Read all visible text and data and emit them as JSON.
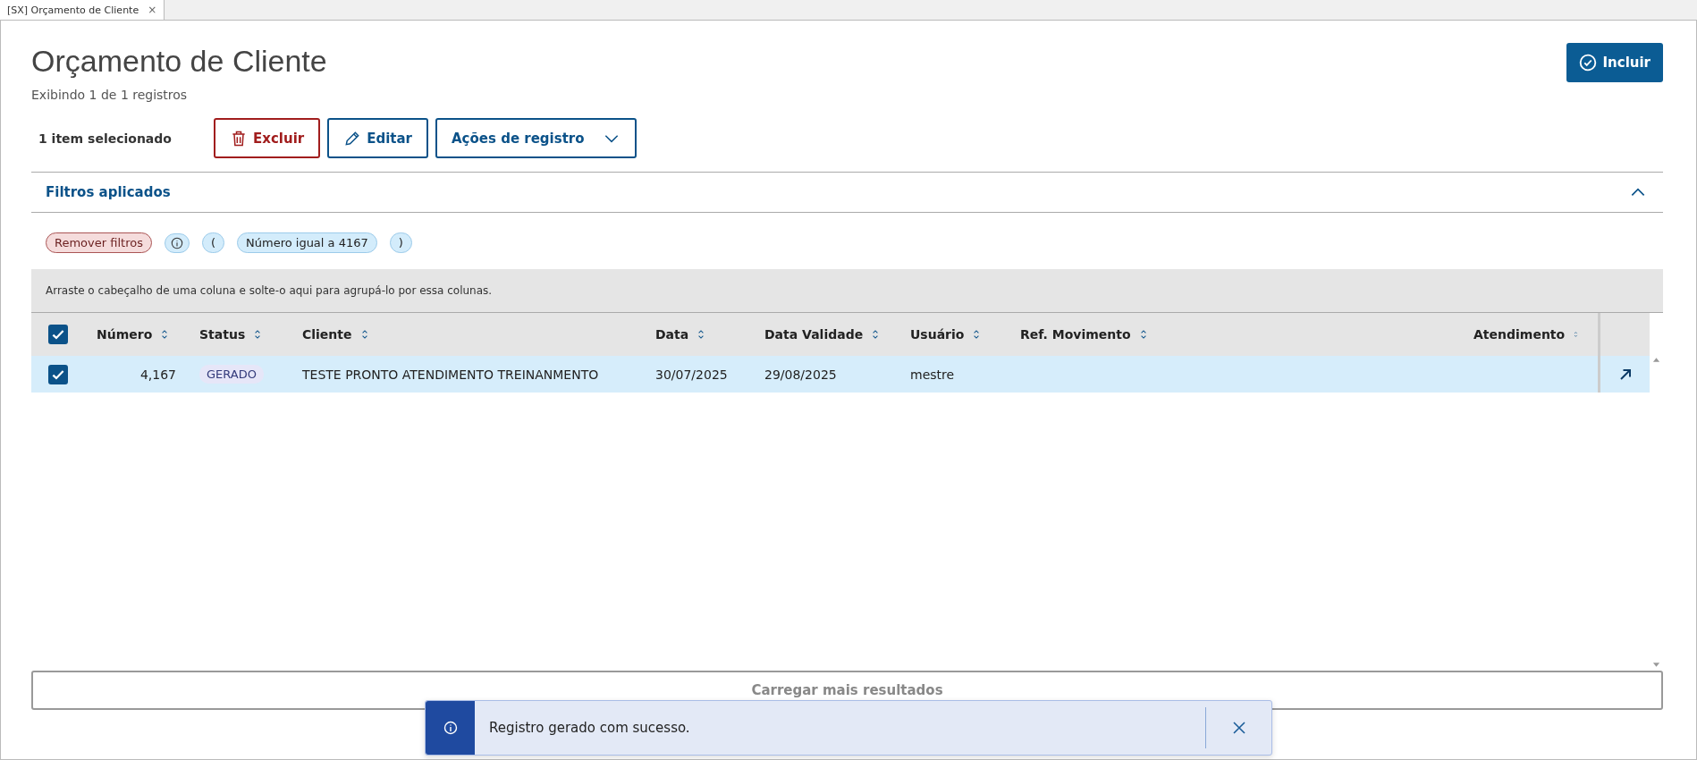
{
  "tabs": [
    {
      "label": "[SX] Orçamento de Cliente",
      "selected": true,
      "close": "×"
    }
  ],
  "header": {
    "title": "Orçamento de Cliente",
    "subtitle": "Exibindo 1 de 1 registros",
    "primary_button": "Incluir"
  },
  "selection": {
    "label": "1 item selecionado",
    "buttons": [
      {
        "kind": "delete",
        "label": "Excluir"
      },
      {
        "kind": "edit",
        "label": "Editar"
      },
      {
        "kind": "menu",
        "label": "Ações de registro"
      }
    ]
  },
  "filters": {
    "title": "Filtros aplicados",
    "expanded": true,
    "chips": [
      {
        "kind": "remove",
        "label": "Remover filtros"
      },
      {
        "kind": "info"
      },
      {
        "kind": "plain",
        "label": "("
      },
      {
        "kind": "plain",
        "label": "Número igual a 4167"
      },
      {
        "kind": "plain",
        "label": ")"
      }
    ]
  },
  "group_hint": "Arraste o cabeçalho de uma coluna e solte-o aqui para agrupá-lo por essa colunas.",
  "table": {
    "all_checked": true,
    "columns": [
      {
        "label": "Número"
      },
      {
        "label": "Status"
      },
      {
        "label": "Cliente"
      },
      {
        "label": "Data"
      },
      {
        "label": "Data Validade"
      },
      {
        "label": "Usuário"
      },
      {
        "label": "Ref. Movimento"
      },
      {
        "label": "Atendimento"
      }
    ],
    "rows": [
      {
        "checked": true,
        "selected": true,
        "cells": [
          "4,167",
          "GERADO",
          "TESTE PRONTO ATENDIMENTO TREINANMENTO",
          "30/07/2025",
          "29/08/2025",
          "mestre"
        ]
      }
    ]
  },
  "load_more": "Carregar mais resultados",
  "toast": {
    "message": "Registro gerado com sucesso."
  }
}
